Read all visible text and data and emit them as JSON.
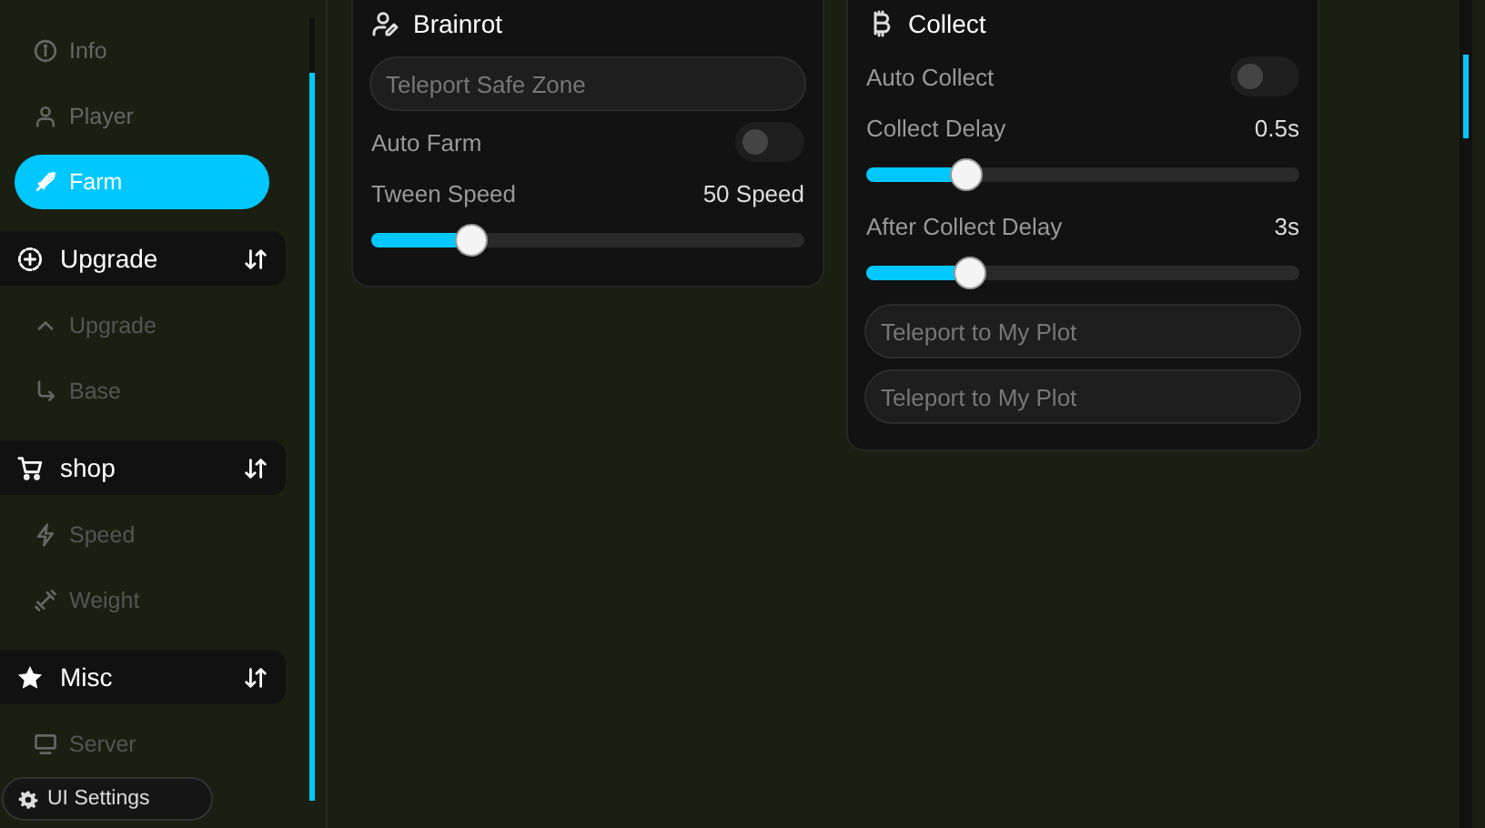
{
  "sidebar": {
    "items": [
      {
        "kind": "tab",
        "label": "Info",
        "selected": false
      },
      {
        "kind": "tab",
        "label": "Player",
        "selected": false
      },
      {
        "kind": "tab",
        "label": "Farm",
        "selected": true
      },
      {
        "kind": "section",
        "label": "Upgrade",
        "children": [
          {
            "label": "Upgrade",
            "selected": false
          },
          {
            "label": "Base",
            "selected": false
          }
        ]
      },
      {
        "kind": "section",
        "label": "shop",
        "children": [
          {
            "label": "Speed",
            "selected": false
          },
          {
            "label": "Weight",
            "selected": false
          }
        ]
      },
      {
        "kind": "section",
        "label": "Misc",
        "children": [
          {
            "label": "Server",
            "selected": false
          }
        ]
      }
    ]
  },
  "settings_button": {
    "label": "UI Settings"
  },
  "cards": [
    {
      "title": "Brainrot",
      "controls": [
        {
          "kind": "button",
          "label": "Teleport Safe Zone"
        },
        {
          "kind": "toggle",
          "label": "Auto Farm",
          "on": false
        },
        {
          "kind": "slider",
          "label": "Tween Speed",
          "reading": "50 Speed",
          "level": 0.21
        }
      ]
    },
    {
      "title": "Collect",
      "controls": [
        {
          "kind": "toggle",
          "label": "Auto Collect",
          "on": false
        },
        {
          "kind": "slider",
          "label": "Collect Delay",
          "reading": "0.5s",
          "level": 0.21
        },
        {
          "kind": "slider",
          "label": "After Collect Delay",
          "reading": "3s",
          "level": 0.22
        },
        {
          "kind": "button",
          "label": "Teleport to My Plot"
        },
        {
          "kind": "button",
          "label": "Teleport to My Plot"
        }
      ]
    }
  ]
}
